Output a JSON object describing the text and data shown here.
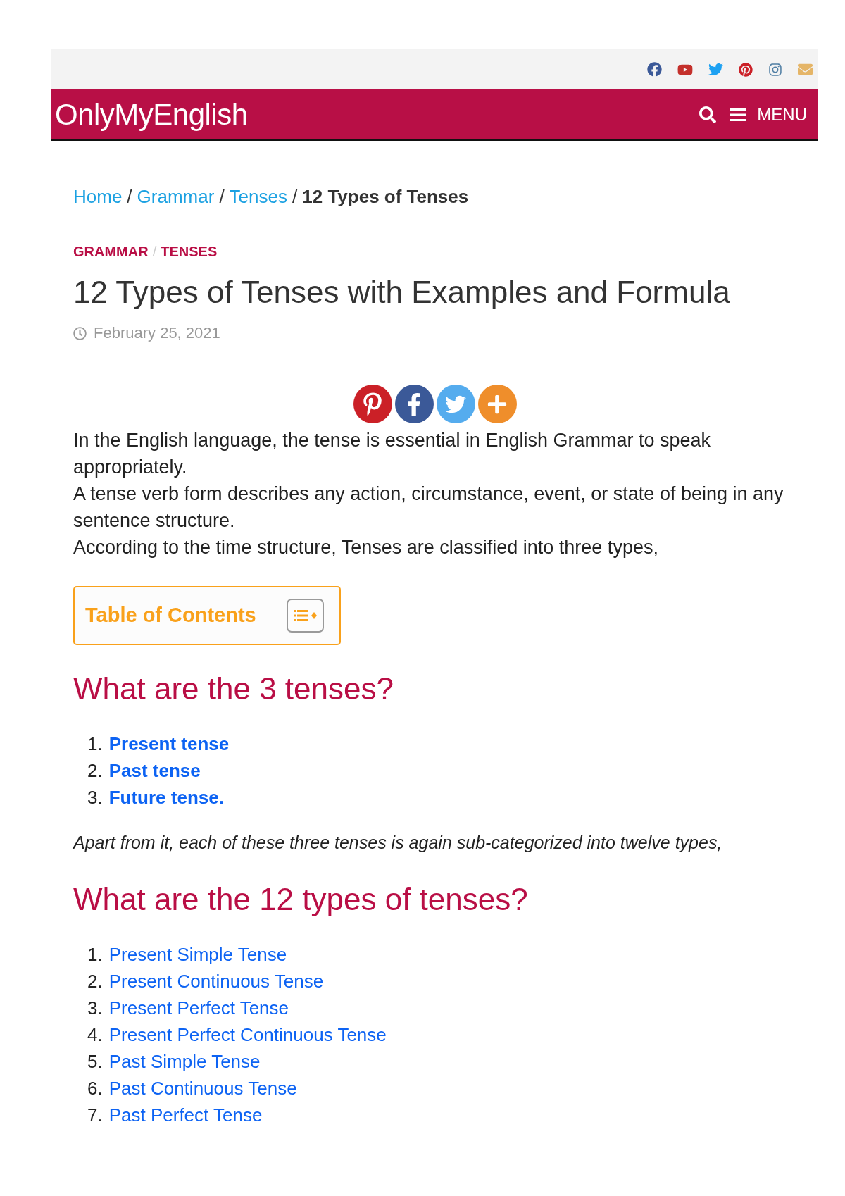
{
  "header": {
    "logo": "OnlyMyEnglish",
    "menu_label": "MENU"
  },
  "breadcrumb": [
    {
      "kind": "link",
      "label": "Home"
    },
    {
      "kind": "separator",
      "label": "/"
    },
    {
      "kind": "link",
      "label": "Grammar"
    },
    {
      "kind": "separator",
      "label": "/"
    },
    {
      "kind": "link",
      "label": "Tenses"
    },
    {
      "kind": "separator",
      "label": "/"
    },
    {
      "kind": "current",
      "label": "12 Types of Tenses"
    }
  ],
  "article": {
    "categories": [
      {
        "kind": "link",
        "label": "GRAMMAR"
      },
      {
        "kind": "separator",
        "label": "/"
      },
      {
        "kind": "link",
        "label": "TENSES"
      }
    ],
    "title": "12 Types of Tenses with Examples and Formula",
    "date": "February 25, 2021",
    "body": [
      {
        "kind": "paragraph",
        "text": "In the English language, the tense is essential in English Grammar to speak appropriately."
      },
      {
        "kind": "paragraph",
        "text": "A tense verb form describes any action, circumstance, event, or state of being in any sentence structure."
      },
      {
        "kind": "paragraph",
        "text": "According to the time structure, Tenses are classified into three types,"
      },
      {
        "kind": "toc",
        "title": "Table of Contents"
      },
      {
        "kind": "heading",
        "text": "What are the 3 tenses?"
      },
      {
        "kind": "summary",
        "items": [
          {
            "number": "1.",
            "label": "Present tense"
          },
          {
            "number": "2.",
            "label": "Past tense"
          },
          {
            "number": "3.",
            "label": "Future tense."
          }
        ]
      },
      {
        "kind": "note",
        "text": "Apart from it, each of these three tenses is again sub-categorized into twelve types,"
      },
      {
        "kind": "heading",
        "text": "What are the 12 types of tenses?"
      },
      {
        "kind": "list",
        "items": [
          {
            "number": "1.",
            "label": "Present Simple Tense"
          },
          {
            "number": "2.",
            "label": "Present Continuous Tense"
          },
          {
            "number": "3.",
            "label": "Present Perfect Tense"
          },
          {
            "number": "4.",
            "label": "Present Perfect Continuous Tense"
          },
          {
            "number": "5.",
            "label": "Past Simple Tense"
          },
          {
            "number": "6.",
            "label": "Past Continuous Tense"
          },
          {
            "number": "7.",
            "label": "Past Perfect Tense"
          }
        ]
      }
    ]
  }
}
